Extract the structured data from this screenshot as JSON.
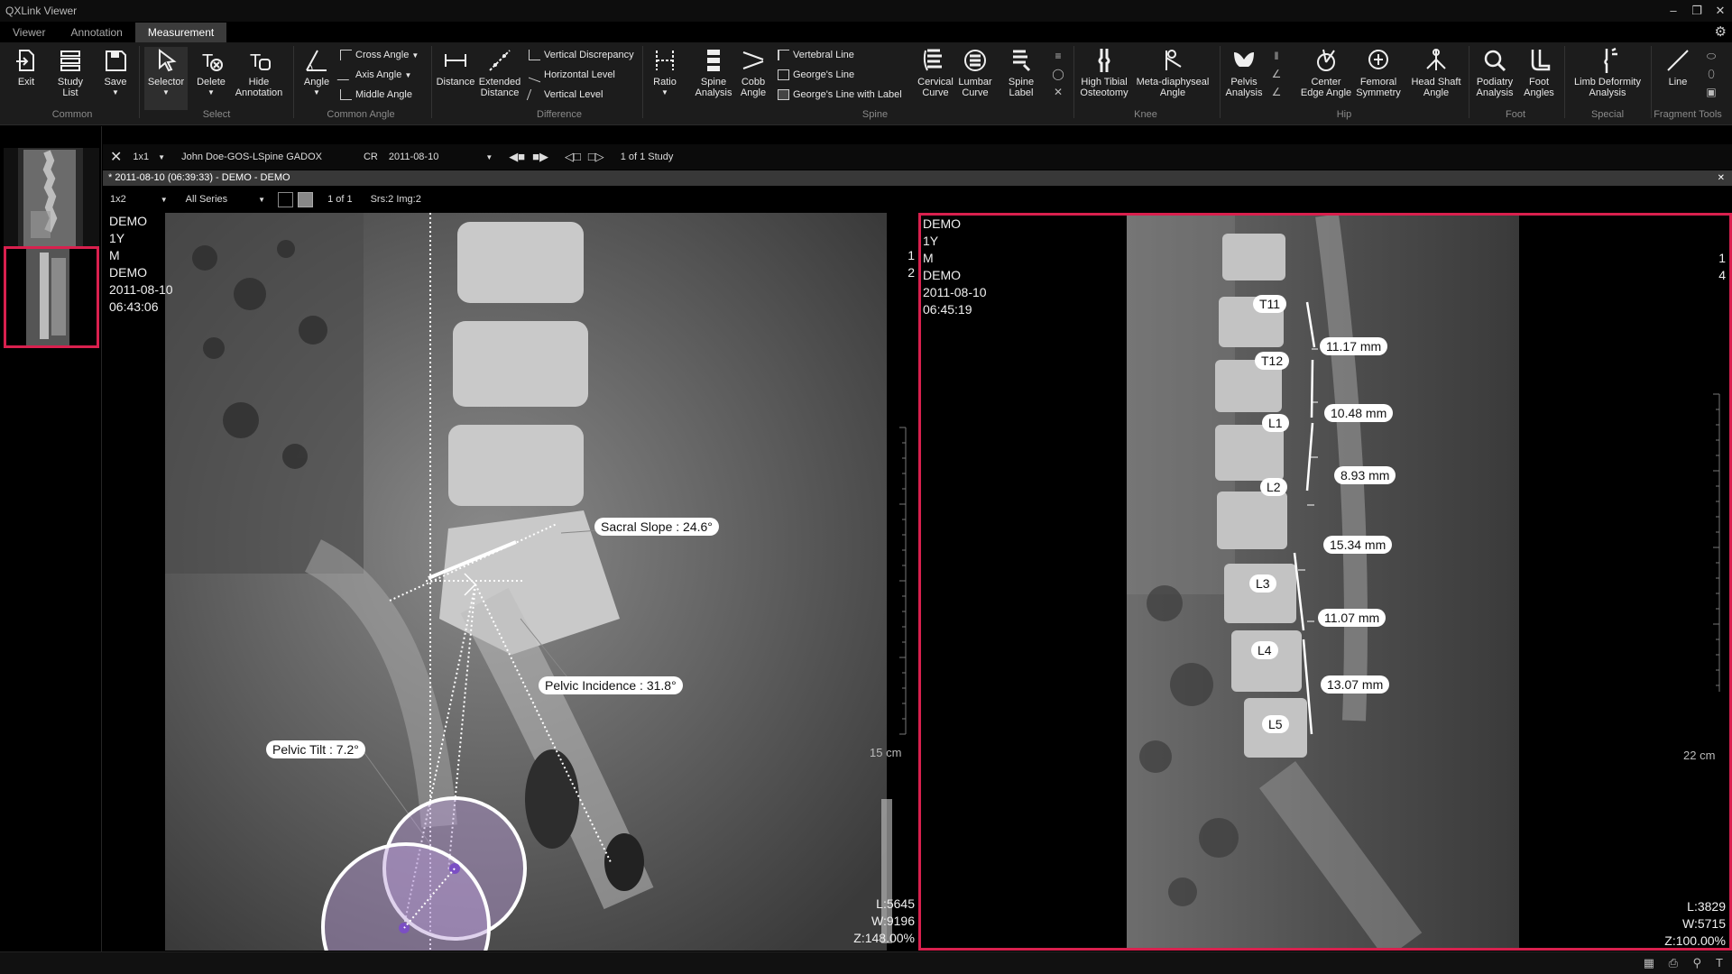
{
  "app": {
    "title": "QXLink Viewer"
  },
  "tabs": [
    "Viewer",
    "Annotation",
    "Measurement"
  ],
  "ribbon": {
    "exit": "Exit",
    "study_list": "Study\nList",
    "save": "Save",
    "selector": "Selector",
    "delete": "Delete",
    "hide_annotation": "Hide\nAnnotation",
    "angle": "Angle",
    "cross_angle": "Cross Angle",
    "axis_angle": "Axis Angle",
    "middle_angle": "Middle Angle",
    "distance": "Distance",
    "extended_distance": "Extended\nDistance",
    "vertical_discrepancy": "Vertical Discrepancy",
    "horizontal_level": "Horizontal Level",
    "vertical_level": "Vertical Level",
    "ratio": "Ratio",
    "spine_analysis": "Spine\nAnalysis",
    "cobb_angle": "Cobb\nAngle",
    "vertebral_line": "Vertebral Line",
    "georges_line": "George's Line",
    "georges_line_label": "George's Line with Label",
    "cervical_curve": "Cervical\nCurve",
    "lumbar_curve": "Lumbar\nCurve",
    "spine_label": "Spine\nLabel",
    "high_tibial": "High Tibial\nOsteotomy",
    "meta_diaphyseal": "Meta-diaphyseal\nAngle",
    "pelvis_analysis": "Pelvis\nAnalysis",
    "center_edge": "Center\nEdge Angle",
    "femoral_symmetry": "Femoral\nSymmetry",
    "head_shaft": "Head Shaft\nAngle",
    "podiatry": "Podiatry\nAnalysis",
    "foot_angles": "Foot\nAngles",
    "limb_deformity": "Limb Deformity\nAnalysis",
    "line": "Line",
    "groups": {
      "common": "Common",
      "select": "Select",
      "common_angle": "Common Angle",
      "difference": "Difference",
      "spine": "Spine",
      "knee": "Knee",
      "hip": "Hip",
      "foot": "Foot",
      "special": "Special",
      "fragment_tools": "Fragment Tools"
    }
  },
  "topbar": {
    "layout": "1x1",
    "patient": "John Doe-GOS-LSpine  GADOX",
    "modality": "CR",
    "date": "2011-08-10",
    "study_count": "1 of 1 Study"
  },
  "study_header": "* 2011-08-10 (06:39:33) - DEMO - DEMO",
  "seriesbar": {
    "layout": "1x2",
    "series": "All Series",
    "page": "1 of 1",
    "info": "Srs:2 Img:2"
  },
  "viewport1": {
    "info": [
      "DEMO",
      "1Y",
      "M",
      "DEMO",
      "2011-08-10",
      "06:43:06"
    ],
    "right_nums": [
      "1",
      "2"
    ],
    "scale": "15 cm",
    "level": "L:5645",
    "width": "W:9196",
    "zoom": "Z:148.00%",
    "labels": {
      "sacral_slope": "Sacral Slope : 24.6°",
      "pelvic_incidence": "Pelvic Incidence : 31.8°",
      "pelvic_tilt": "Pelvic Tilt :  7.2°"
    }
  },
  "viewport2": {
    "info": [
      "DEMO",
      "1Y",
      "M",
      "DEMO",
      "2011-08-10",
      "06:45:19"
    ],
    "right_nums": [
      "1",
      "4"
    ],
    "scale": "22 cm",
    "level": "L:3829",
    "width": "W:5715",
    "zoom": "Z:100.00%",
    "vertebrae": [
      "T11",
      "T12",
      "L1",
      "L2",
      "L3",
      "L4",
      "L5"
    ],
    "distances": [
      "11.17 mm",
      "10.48 mm",
      "8.93 mm",
      "15.34 mm",
      "11.07 mm",
      "13.07 mm"
    ]
  },
  "colors": {
    "accent": "#d9204e",
    "circle_fill": "#b79cd6"
  }
}
